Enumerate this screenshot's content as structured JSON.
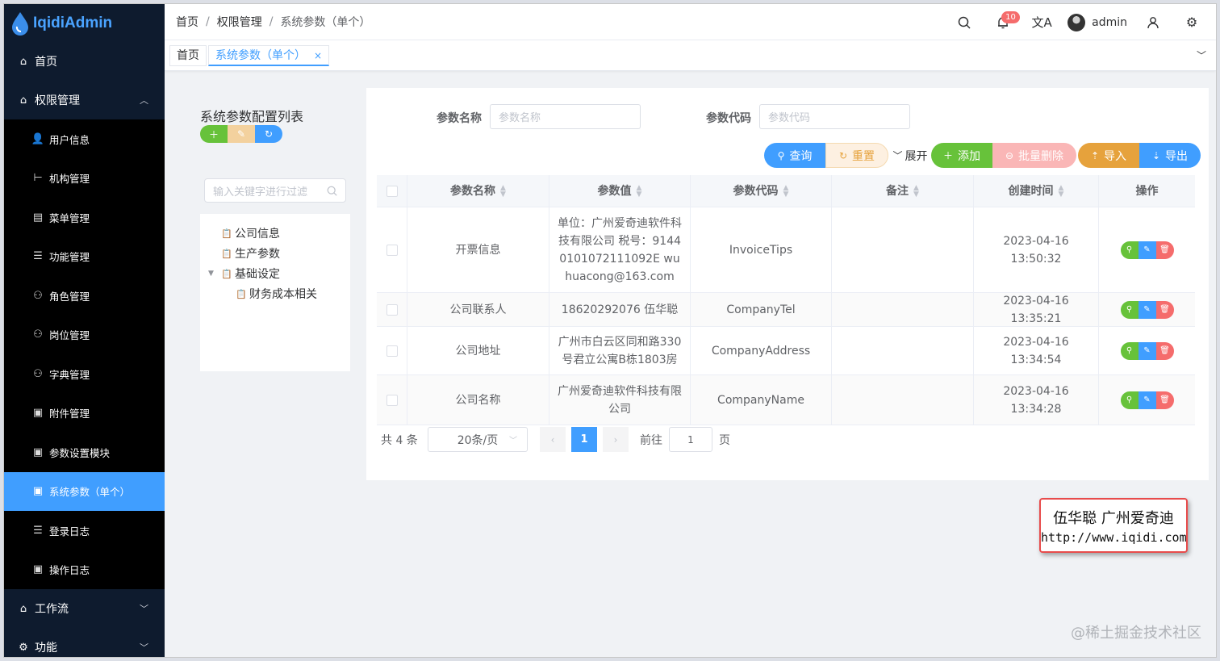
{
  "app": {
    "logo_text": "IqidiAdmin"
  },
  "sidebar": {
    "home": "首页",
    "group_permission": "权限管理",
    "items": [
      {
        "label": "用户信息",
        "icon": "user-icon"
      },
      {
        "label": "机构管理",
        "icon": "org-tree-icon"
      },
      {
        "label": "菜单管理",
        "icon": "menu-icon"
      },
      {
        "label": "功能管理",
        "icon": "list-icon"
      },
      {
        "label": "角色管理",
        "icon": "users-icon"
      },
      {
        "label": "岗位管理",
        "icon": "users-icon"
      },
      {
        "label": "字典管理",
        "icon": "users-icon"
      },
      {
        "label": "附件管理",
        "icon": "doc-icon"
      },
      {
        "label": "参数设置模块",
        "icon": "doc-icon"
      },
      {
        "label": "系统参数（单个）",
        "icon": "doc-icon"
      },
      {
        "label": "登录日志",
        "icon": "list-icon"
      },
      {
        "label": "操作日志",
        "icon": "doc-icon"
      }
    ],
    "workflow": "工作流",
    "function": "功能"
  },
  "header": {
    "breadcrumb": [
      "首页",
      "权限管理",
      "系统参数（单个）"
    ],
    "separator": "/",
    "notification_count": "10",
    "username": "admin"
  },
  "tags": {
    "home": "首页",
    "current": "系统参数（单个）",
    "close": "×"
  },
  "left_panel": {
    "title": "系统参数配置列表",
    "filter_placeholder": "输入关键字进行过滤",
    "tree": [
      "公司信息",
      "生产参数",
      "基础设定",
      "财务成本相关"
    ]
  },
  "search": {
    "name_label": "参数名称",
    "name_placeholder": "参数名称",
    "code_label": "参数代码",
    "code_placeholder": "参数代码"
  },
  "toolbar": {
    "query": "查询",
    "reset": "重置",
    "expand": "展开",
    "add": "添加",
    "batch_delete": "批量删除",
    "import": "导入",
    "export": "导出"
  },
  "table": {
    "headers": [
      "参数名称",
      "参数值",
      "参数代码",
      "备注",
      "创建时间",
      "操作"
    ],
    "rows": [
      {
        "name": "开票信息",
        "value": "单位：广州爱奇迪软件科技有限公司 税号：91440101072111092E wuhuacong@163.com",
        "code": "InvoiceTips",
        "remark": "",
        "created": "2023-04-16 13:50:32"
      },
      {
        "name": "公司联系人",
        "value": "18620292076 伍华聪",
        "code": "CompanyTel",
        "remark": "",
        "created": "2023-04-16 13:35:21"
      },
      {
        "name": "公司地址",
        "value": "广州市白云区同和路330号君立公寓B栋1803房",
        "code": "CompanyAddress",
        "remark": "",
        "created": "2023-04-16 13:34:54"
      },
      {
        "name": "公司名称",
        "value": "广州爱奇迪软件科技有限公司",
        "code": "CompanyName",
        "remark": "",
        "created": "2023-04-16 13:34:28"
      }
    ]
  },
  "pagination": {
    "total": "共 4 条",
    "page_size": "20条/页",
    "current": "1",
    "goto": "前往",
    "goto_value": "1",
    "page_suffix": "页"
  },
  "stamp": {
    "line1": "伍华聪 广州爱奇迪",
    "line2": "http://www.iqidi.com"
  },
  "watermark": "@稀土掘金技术社区",
  "colors": {
    "primary": "#409eff",
    "success": "#67c23a",
    "danger": "#f56c6c",
    "warning": "#e6a23c",
    "sidebar": "#0e1b2e"
  }
}
